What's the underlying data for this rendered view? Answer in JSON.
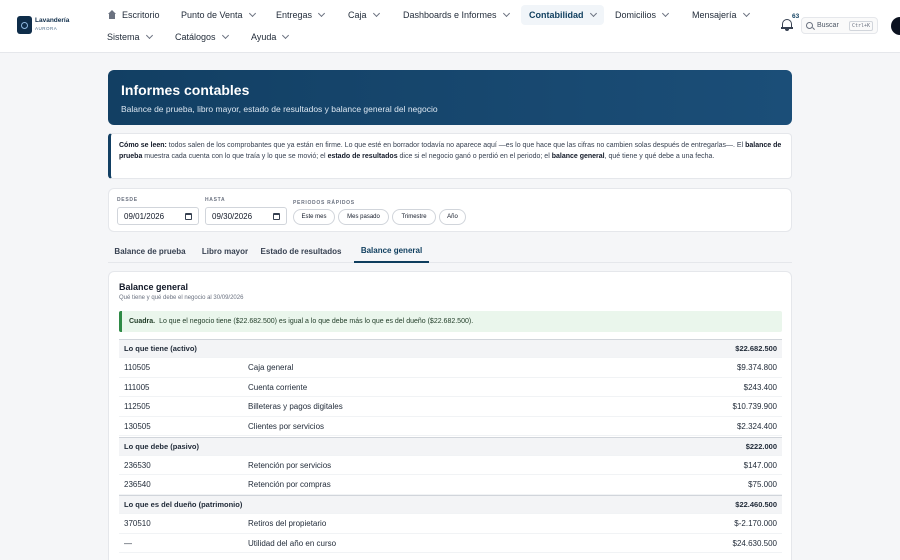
{
  "brand": {
    "name": "Lavandería",
    "sub": "AURORA"
  },
  "nav": {
    "row1": [
      {
        "label": "Escritorio"
      },
      {
        "label": "Punto de Venta"
      },
      {
        "label": "Entregas"
      },
      {
        "label": "Caja"
      },
      {
        "label": "Dashboards e Informes"
      },
      {
        "label": "Contabilidad",
        "active": true
      },
      {
        "label": "Domicilios"
      },
      {
        "label": "Mensajería"
      }
    ],
    "row2": [
      {
        "label": "Sistema"
      },
      {
        "label": "Catálogos"
      },
      {
        "label": "Ayuda"
      }
    ],
    "notifications": "63",
    "search_label": "Buscar",
    "search_shortcut": "Ctrl+K"
  },
  "hero": {
    "title": "Informes contables",
    "subtitle": "Balance de prueba, libro mayor, estado de resultados y balance general del negocio"
  },
  "info": {
    "lead": "Cómo se leen:",
    "t1": " todos salen de los comprobantes que ya están en firme. Lo que esté en borrador todavía no aparece aquí —es lo que hace que las cifras no cambien solas después de entregarlas—. El ",
    "b1": "balance de prueba",
    "t2": " muestra cada cuenta con lo que traía y lo que se movió; el ",
    "b2": "estado de resultados",
    "t3": " dice si el negocio ganó o perdió en el periodo; el ",
    "b3": "balance general",
    "t4": ", qué tiene y qué debe a una fecha."
  },
  "filters": {
    "from_label": "DESDE",
    "from_value": "09/01/2026",
    "to_label": "HASTA",
    "to_value": "09/30/2026",
    "quick_label": "PERIODOS RÁPIDOS",
    "quick": [
      "Este mes",
      "Mes pasado",
      "Trimestre",
      "Año"
    ]
  },
  "tabs": [
    {
      "label": "Balance de prueba"
    },
    {
      "label": "Libro mayor"
    },
    {
      "label": "Estado de resultados"
    },
    {
      "label": "Balance general",
      "active": true
    }
  ],
  "balance": {
    "title": "Balance general",
    "subtitle": "Qué tiene y qué debe el negocio al 30/09/2026",
    "banner_lead": "Cuadra.",
    "banner_text": "Lo que el negocio tiene ($22.682.500) es igual a lo que debe más lo que es del dueño ($22.682.500).",
    "rows": [
      {
        "type": "section",
        "label": "Lo que tiene (activo)",
        "amount": "$22.682.500"
      },
      {
        "code": "110505",
        "name": "Caja general",
        "amount": "$9.374.800"
      },
      {
        "code": "111005",
        "name": "Cuenta corriente",
        "amount": "$243.400"
      },
      {
        "code": "112505",
        "name": "Billeteras y pagos digitales",
        "amount": "$10.739.900"
      },
      {
        "code": "130505",
        "name": "Clientes por servicios",
        "amount": "$2.324.400"
      },
      {
        "type": "section",
        "label": "Lo que debe (pasivo)",
        "amount": "$222.000"
      },
      {
        "code": "236530",
        "name": "Retención por servicios",
        "amount": "$147.000"
      },
      {
        "code": "236540",
        "name": "Retención por compras",
        "amount": "$75.000"
      },
      {
        "type": "section",
        "label": "Lo que es del dueño (patrimonio)",
        "amount": "$22.460.500"
      },
      {
        "code": "370510",
        "name": "Retiros del propietario",
        "amount": "$-2.170.000"
      },
      {
        "code": "—",
        "name": "Utilidad del año en curso",
        "amount": "$24.630.500"
      }
    ]
  }
}
